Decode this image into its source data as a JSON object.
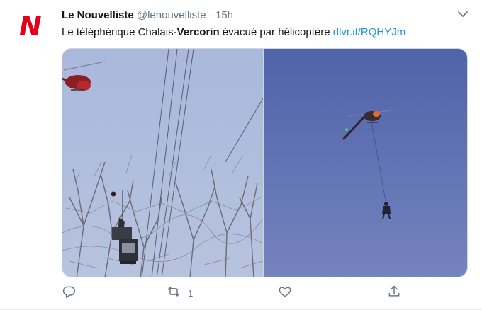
{
  "tweet": {
    "author_name": "Le Nouvelliste",
    "author_handle": "@lenouvelliste",
    "separator": "·",
    "time": "15h",
    "avatar_letter": "N",
    "text_part1": "Le téléphérique Chalais-",
    "text_bold": "Vercorin",
    "text_part2": " évacué par hélicoptère ",
    "link": "dlvr.it/RQHYJm",
    "retweet_count": "1",
    "brand_color": "#e4001b",
    "link_color": "#1b95e0"
  },
  "icons": {
    "menu": "chevron-down-icon",
    "reply": "reply-icon",
    "retweet": "retweet-icon",
    "like": "heart-icon",
    "share": "share-icon"
  }
}
